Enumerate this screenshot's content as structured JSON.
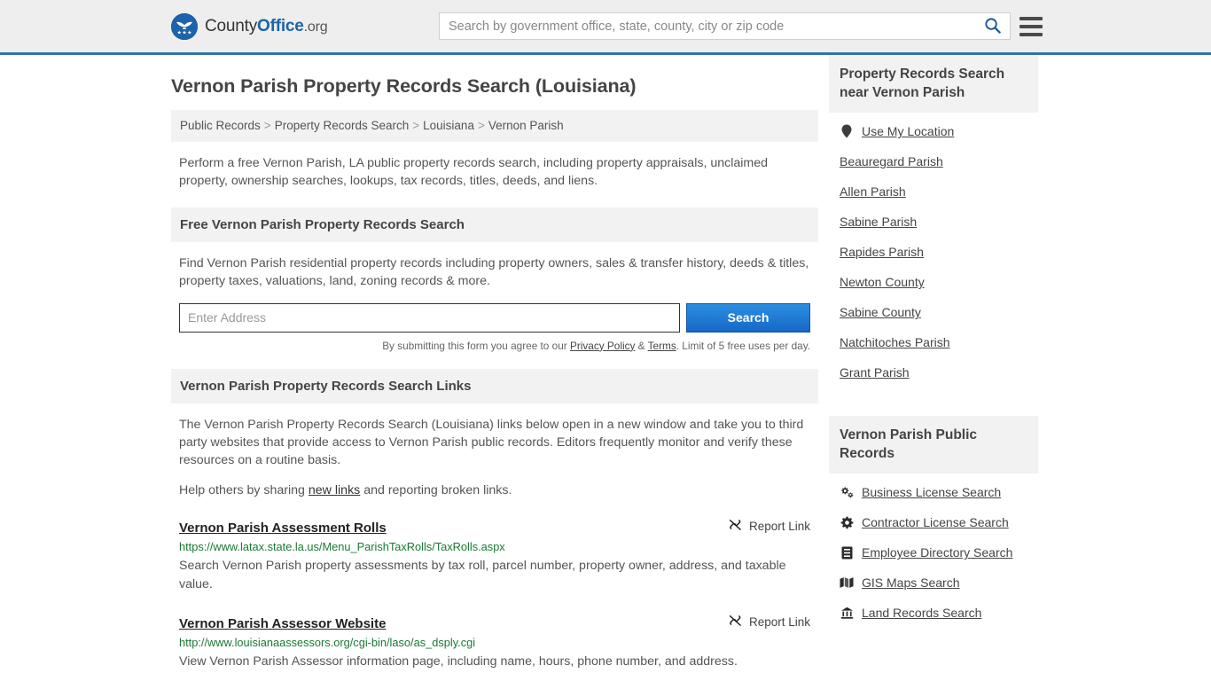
{
  "header": {
    "brand": {
      "part1": "County",
      "part2": "Office",
      "part3": ".org",
      "logo_icon": "eagle-stars-logo"
    },
    "search_placeholder": "Search by government office, state, county, city or zip code",
    "search_value": "",
    "search_icon": "search-icon",
    "menu_icon": "hamburger-menu-icon"
  },
  "page_title": "Vernon Parish Property Records Search (Louisiana)",
  "breadcrumb": {
    "items": [
      "Public Records",
      "Property Records Search",
      "Louisiana",
      "Vernon Parish"
    ],
    "separator": ">"
  },
  "intro": "Perform a free Vernon Parish, LA public property records search, including property appraisals, unclaimed property, ownership searches, lookups, tax records, titles, deeds, and liens.",
  "search_section": {
    "heading": "Free Vernon Parish Property Records Search",
    "description": "Find Vernon Parish residential property records including property owners, sales & transfer history, deeds & titles, property taxes, valuations, land, zoning records & more.",
    "address_placeholder": "Enter Address",
    "address_value": "",
    "button_label": "Search",
    "fineprint_pre": "By submitting this form you agree to our ",
    "fineprint_privacy": "Privacy Policy",
    "fineprint_amp": " & ",
    "fineprint_terms": "Terms",
    "fineprint_post": ". Limit of 5 free uses per day."
  },
  "links_section": {
    "heading": "Vernon Parish Property Records Search Links",
    "description": "The Vernon Parish Property Records Search (Louisiana) links below open in a new window and take you to third party websites that provide access to Vernon Parish public records. Editors frequently monitor and verify these resources on a routine basis.",
    "help_pre": "Help others by sharing ",
    "help_link": "new links",
    "help_post": " and reporting broken links.",
    "report_label": "Report Link",
    "report_icon": "broken-link-icon",
    "results": [
      {
        "title": "Vernon Parish Assessment Rolls",
        "url": "https://www.latax.state.la.us/Menu_ParishTaxRolls/TaxRolls.aspx",
        "description": "Search Vernon Parish property assessments by tax roll, parcel number, property owner, address, and taxable value."
      },
      {
        "title": "Vernon Parish Assessor Website",
        "url": "http://www.louisianaassessors.org/cgi-bin/laso/as_dsply.cgi",
        "description": "View Vernon Parish Assessor information page, including name, hours, phone number, and address."
      }
    ]
  },
  "sidebar": {
    "nearby": {
      "heading": "Property Records Search near Vernon Parish",
      "items": [
        {
          "label": "Use My Location",
          "icon": "map-pin-icon"
        },
        {
          "label": "Beauregard Parish",
          "icon": ""
        },
        {
          "label": "Allen Parish",
          "icon": ""
        },
        {
          "label": "Sabine Parish",
          "icon": ""
        },
        {
          "label": "Rapides Parish",
          "icon": ""
        },
        {
          "label": "Newton County",
          "icon": ""
        },
        {
          "label": "Sabine County",
          "icon": ""
        },
        {
          "label": "Natchitoches Parish",
          "icon": ""
        },
        {
          "label": "Grant Parish",
          "icon": ""
        }
      ]
    },
    "public_records": {
      "heading": "Vernon Parish Public Records",
      "items": [
        {
          "label": "Business License Search",
          "icon": "cogs-icon"
        },
        {
          "label": "Contractor License Search",
          "icon": "cog-icon"
        },
        {
          "label": "Employee Directory Search",
          "icon": "id-card-icon"
        },
        {
          "label": "GIS Maps Search",
          "icon": "map-icon"
        },
        {
          "label": "Land Records Search",
          "icon": "landmark-icon"
        }
      ]
    }
  },
  "colors": {
    "brand_blue": "#1c63ab",
    "header_bg": "#eeeeee",
    "header_border": "#3273a8",
    "button_blue": "#1668c8",
    "url_green": "#1a7a33",
    "panel_gray": "#f2f2f2"
  }
}
